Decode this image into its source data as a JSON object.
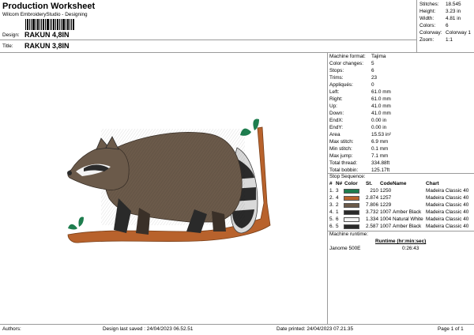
{
  "header": {
    "title": "Production Worksheet",
    "subtitle": "Wilcom EmbroideryStudio - Designing",
    "design_label": "Design:",
    "design_value": "RAKUN 4,8IN",
    "title_label": "Title:",
    "title_value": "RAKUN 3,8IN"
  },
  "summary": [
    {
      "label": "Stitches:",
      "value": "18.545"
    },
    {
      "label": "Height:",
      "value": "3.23 in"
    },
    {
      "label": "Width:",
      "value": "4.81 in"
    },
    {
      "label": "Colors:",
      "value": "6"
    },
    {
      "label": "Colorway:",
      "value": "Colorway 1"
    },
    {
      "label": "Zoom:",
      "value": "1:1"
    }
  ],
  "machine_info": [
    {
      "label": "Machine format:",
      "value": "Tajima"
    },
    {
      "label": "Color changes:",
      "value": "5"
    },
    {
      "label": "Stops:",
      "value": "6"
    },
    {
      "label": "Trims:",
      "value": "23"
    },
    {
      "label": "Appliqués:",
      "value": "0"
    },
    {
      "label": "Left:",
      "value": "61.0 mm"
    },
    {
      "label": "Right:",
      "value": "61.0 mm"
    },
    {
      "label": "Up:",
      "value": "41.0 mm"
    },
    {
      "label": "Down:",
      "value": "41.0 mm"
    },
    {
      "label": "EndX:",
      "value": "0.00 in"
    },
    {
      "label": "EndY:",
      "value": "0.00 in"
    },
    {
      "label": "Area",
      "value": "15.53 in²"
    },
    {
      "label": "Max stitch:",
      "value": "6.9 mm"
    },
    {
      "label": "Min stitch:",
      "value": "0.1 mm"
    },
    {
      "label": "Max jump:",
      "value": "7.1 mm"
    },
    {
      "label": "Total thread:",
      "value": "334.88ft"
    },
    {
      "label": "Total bobbin:",
      "value": "125.17ft"
    }
  ],
  "stop_sequence": {
    "title": "Stop Sequence:",
    "headers": {
      "num": "#",
      "n": "N#",
      "color": "Color",
      "st": "St.",
      "code": "Code",
      "name": "Name",
      "chart": "Chart"
    },
    "rows": [
      {
        "num": "1.",
        "n": "3",
        "color": "#1e7d4e",
        "st": "210",
        "code": "1250",
        "name": "",
        "chart": "Madeira Classic 40"
      },
      {
        "num": "2.",
        "n": "4",
        "color": "#b8622c",
        "st": "2.874",
        "code": "1257",
        "name": "",
        "chart": "Madeira Classic 40"
      },
      {
        "num": "3.",
        "n": "2",
        "color": "#6b5a4a",
        "st": "7.806",
        "code": "1229",
        "name": "",
        "chart": "Madeira Classic 40"
      },
      {
        "num": "4.",
        "n": "1",
        "color": "#2a2a2a",
        "st": "3.732",
        "code": "1007",
        "name": "Amber Black",
        "chart": "Madeira Classic 40"
      },
      {
        "num": "5.",
        "n": "6",
        "color": "#f4f4f4",
        "st": "1.334",
        "code": "1004",
        "name": "Natural White",
        "chart": "Madeira Classic 40"
      },
      {
        "num": "6.",
        "n": "5",
        "color": "#2a2a2a",
        "st": "2.587",
        "code": "1007",
        "name": "Amber Black",
        "chart": "Madeira Classic 40"
      }
    ]
  },
  "runtime": {
    "title": "Machine runtime:",
    "col_runtime": "Runtime (hr:min:sec)",
    "machine": "Janome 500E",
    "value": "0:26:43"
  },
  "footer": {
    "authors": "Authors:",
    "last_saved": "Design last saved : 24/04/2023 06.52.51",
    "printed": "Date printed: 24/04/2023 07.21.35",
    "page": "Page 1 of 1"
  },
  "colors": {
    "fur_body": "#6b5a4a",
    "fur_dark": "#2a2a2a",
    "branch": "#b8622c",
    "leaf": "#1e7d4e"
  }
}
